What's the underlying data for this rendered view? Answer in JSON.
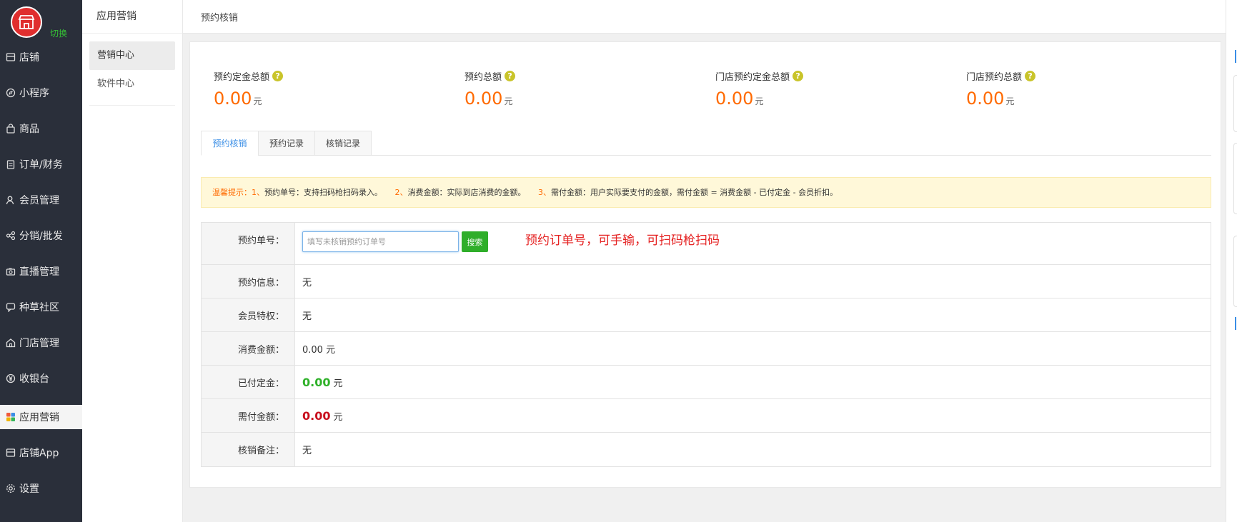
{
  "brand": {
    "switch_label": "切换"
  },
  "sidebar": {
    "items": [
      {
        "label": "店铺",
        "icon": "store-icon"
      },
      {
        "label": "小程序",
        "icon": "compass-icon"
      },
      {
        "label": "商品",
        "icon": "bag-icon"
      },
      {
        "label": "订单/财务",
        "icon": "clipboard-icon"
      },
      {
        "label": "会员管理",
        "icon": "user-icon"
      },
      {
        "label": "分销/批发",
        "icon": "share-icon"
      },
      {
        "label": "直播管理",
        "icon": "camera-icon"
      },
      {
        "label": "种草社区",
        "icon": "chat-icon"
      },
      {
        "label": "门店管理",
        "icon": "house-icon"
      },
      {
        "label": "收银台",
        "icon": "yen-icon"
      },
      {
        "label": "应用营销",
        "icon": "apps-icon",
        "active": true
      },
      {
        "label": "店铺App",
        "icon": "store-app-icon"
      },
      {
        "label": "设置",
        "icon": "gear-icon"
      }
    ]
  },
  "subnav": {
    "title": "应用营销",
    "items": [
      {
        "label": "营销中心",
        "active": true
      },
      {
        "label": "软件中心"
      }
    ]
  },
  "topbar": {
    "title": "预约核销"
  },
  "stats": [
    {
      "label": "预约定金总额",
      "value": "0.00",
      "unit": "元"
    },
    {
      "label": "预约总额",
      "value": "0.00",
      "unit": "元"
    },
    {
      "label": "门店预约定金总额",
      "value": "0.00",
      "unit": "元"
    },
    {
      "label": "门店预约总额",
      "value": "0.00",
      "unit": "元"
    }
  ],
  "tabs": [
    {
      "label": "预约核销",
      "active": true
    },
    {
      "label": "预约记录"
    },
    {
      "label": "核销记录"
    }
  ],
  "tip": {
    "prefix": "温馨提示：",
    "p1_num": "1、",
    "p1_text": "预约单号：支持扫码枪扫码录入。",
    "p2_num": "2、",
    "p2_text": "消费金额：实际到店消费的金额。",
    "p3_num": "3、",
    "p3_text": "需付金额：用户实际要支付的金额，需付金额 = 消费金额 - 已付定金 - 会员折扣。"
  },
  "form": {
    "order_label": "预约单号：",
    "order_placeholder": "填写未核销预约订单号",
    "search_label": "搜索",
    "annotation": "预约订单号，可手输，可扫码枪扫码",
    "info_label": "预约信息：",
    "info_value": "无",
    "privilege_label": "会员特权：",
    "privilege_value": "无",
    "consume_label": "消费金额：",
    "consume_value": "0.00 元",
    "paid_label": "已付定金：",
    "paid_value": "0.00",
    "paid_unit": "元",
    "due_label": "需付金额：",
    "due_value": "0.00",
    "due_unit": "元",
    "remark_label": "核销备注：",
    "remark_value": "无"
  },
  "colors": {
    "accent": "#ff6a00",
    "sidebar": "#2a2f3a",
    "green": "#2fb12a",
    "red": "#c8101e",
    "link": "#3a8ee6"
  }
}
